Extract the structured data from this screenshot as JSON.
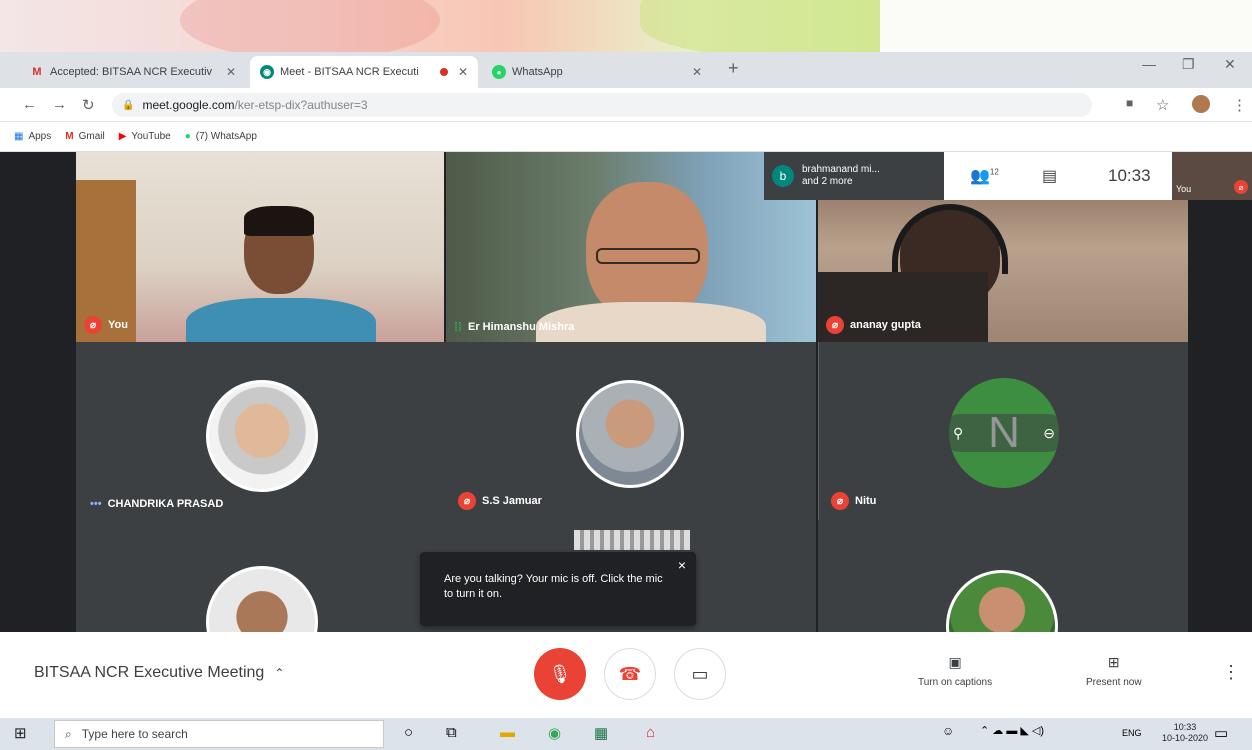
{
  "browser": {
    "tabs": [
      {
        "label": "Accepted: BITSAA NCR Executiv",
        "favicon": "gmail-icon"
      },
      {
        "label": "Meet - BITSAA NCR Executi",
        "favicon": "meet-icon"
      },
      {
        "label": "WhatsApp",
        "favicon": "whatsapp-icon"
      }
    ],
    "url_host": "meet.google.com",
    "url_path": "/ker-etsp-dix?authuser=3",
    "bookmarks": [
      "Apps",
      "Gmail",
      "YouTube",
      "(7) WhatsApp"
    ]
  },
  "meet": {
    "banner": {
      "avatar_letter": "b",
      "name_line1": "brahmanand mi...",
      "name_line2": "and 2 more",
      "participants_count": "12",
      "time": "10:33",
      "self_label": "You"
    },
    "tiles": [
      {
        "name": "You"
      },
      {
        "name": "Er Himanshu Mishra"
      },
      {
        "name": "ananay gupta"
      },
      {
        "name": "CHANDRIKA PRASAD"
      },
      {
        "name": "S.S Jamuar"
      },
      {
        "name": "Nitu",
        "avatar_letter": "N"
      }
    ],
    "toast": "Are you talking? Your mic is off. Click the mic to turn it on.",
    "toast_close": "×"
  },
  "bottom": {
    "meeting_title": "BITSAA NCR Executive Meeting",
    "captions_label": "Turn on captions",
    "present_label": "Present now"
  },
  "taskbar": {
    "search_placeholder": "Type here to search",
    "lang": "ENG",
    "time": "10:33",
    "date": "10-10-2020"
  }
}
